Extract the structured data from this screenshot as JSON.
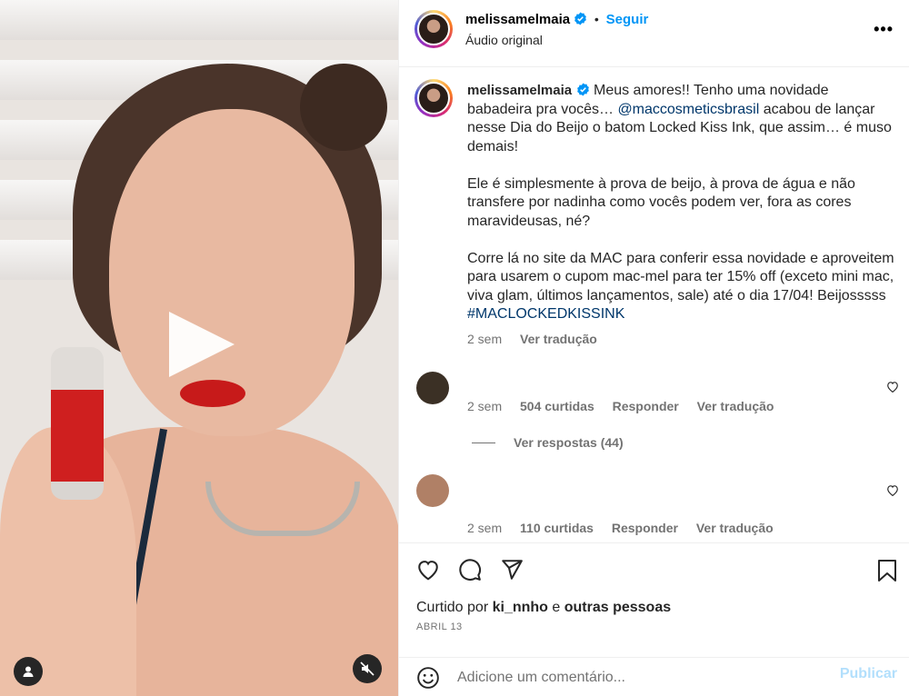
{
  "post": {
    "username": "melissamelmaia",
    "follow_label": "Seguir",
    "audio_label": "Áudio original",
    "more_label": "•••"
  },
  "caption": {
    "username": "melissamelmaia",
    "p1_a": "Meus amores!! Tenho uma novidade babadeira pra vocês… ",
    "p1_mention": "@maccosmeticsbrasil",
    "p1_b": " acabou de lançar nesse Dia do Beijo o batom Locked Kiss Ink, que assim… é muso demais!",
    "p2": "Ele é simplesmente à prova de beijo, à prova de água e não transfere por nadinha como vocês podem ver, fora as cores maravideusas, né?",
    "p3_a": "Corre lá no site da MAC para conferir essa novidade e aproveitem para usarem o cupom mac-mel para ter 15% off (exceto mini mac, viva glam, últimos lançamentos, sale) até o dia 17/04! Beijosssss ",
    "p3_hashtag": "#MACLOCKEDKISSINK",
    "time": "2 sem",
    "translate": "Ver tradução"
  },
  "comments": [
    {
      "time": "2 sem",
      "likes": "504 curtidas",
      "reply": "Responder",
      "translate": "Ver tradução",
      "view_replies": "Ver respostas (44)",
      "avatar_color": "#3b3025"
    },
    {
      "time": "2 sem",
      "likes": "110 curtidas",
      "reply": "Responder",
      "translate": "Ver tradução",
      "avatar_color": "#b08066"
    }
  ],
  "actions": {
    "liked_by_prefix": "Curtido por ",
    "liked_by_user": "ki_nnho",
    "liked_by_middle": " e ",
    "liked_by_rest": "outras pessoas",
    "date": "ABRIL 13"
  },
  "comment_box": {
    "placeholder": "Adicione um comentário...",
    "publish_label": "Publicar"
  },
  "colors": {
    "accent": "#0095f6",
    "verified": "#0095f6",
    "publish_disabled": "#b2dffc",
    "link": "#00376b"
  }
}
